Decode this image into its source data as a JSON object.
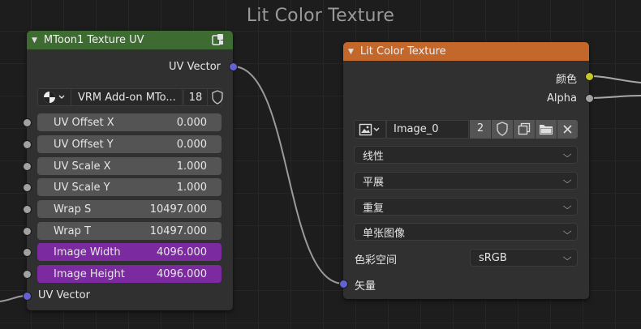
{
  "frame": {
    "title": "Lit Color Texture"
  },
  "node_uv": {
    "title": "MToon1 Texture UV",
    "header_color": "#3e6b32",
    "output_label": "UV Vector",
    "datablock": {
      "name": "VRM Add-on MTo...",
      "users": "18"
    },
    "fields": [
      {
        "label": "UV Offset X",
        "value": "0.000"
      },
      {
        "label": "UV Offset Y",
        "value": "0.000"
      },
      {
        "label": "UV Scale X",
        "value": "1.000"
      },
      {
        "label": "UV Scale Y",
        "value": "1.000"
      },
      {
        "label": "Wrap S",
        "value": "10497.000"
      },
      {
        "label": "Wrap T",
        "value": "10497.000"
      },
      {
        "label": "Image Width",
        "value": "4096.000"
      },
      {
        "label": "Image Height",
        "value": "4096.000"
      }
    ],
    "input_label": "UV Vector"
  },
  "node_tex": {
    "title": "Lit Color Texture",
    "header_color": "#c4672a",
    "outputs": {
      "color": "颜色",
      "alpha": "Alpha"
    },
    "image": {
      "name": "Image_0",
      "users": "2"
    },
    "interpolation": "线性",
    "projection": "平展",
    "extension": "重复",
    "source": "单张图像",
    "color_space_label": "色彩空间",
    "color_space_value": "sRGB",
    "vector_input": "矢量"
  },
  "colors": {
    "vector_socket": "#6262d4",
    "color_socket": "#c7c729",
    "gray_socket": "#a1a1a1",
    "purple_field": "#7b2aa0"
  }
}
